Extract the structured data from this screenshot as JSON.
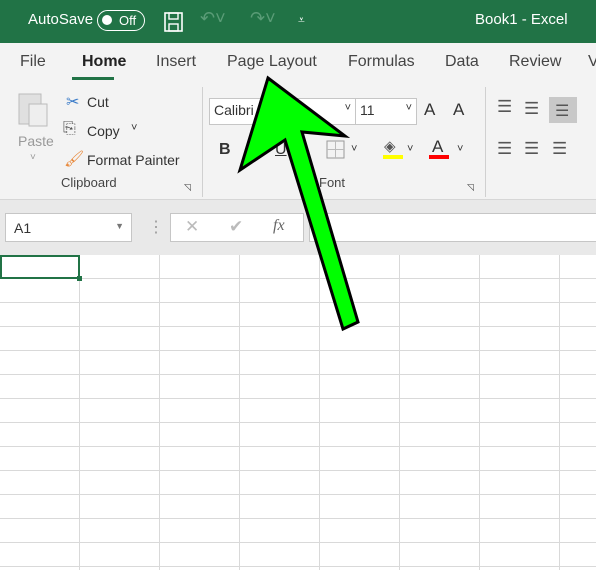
{
  "titlebar": {
    "autosave_label": "AutoSave",
    "autosave_state": "Off",
    "title": "Book1  -  Excel"
  },
  "tabs": [
    {
      "label": "File"
    },
    {
      "label": "Home",
      "active": true
    },
    {
      "label": "Insert"
    },
    {
      "label": "Page Layout"
    },
    {
      "label": "Formulas"
    },
    {
      "label": "Data"
    },
    {
      "label": "Review"
    },
    {
      "label": "V"
    }
  ],
  "clipboard": {
    "paste": "Paste",
    "cut": "Cut",
    "copy": "Copy",
    "format_painter": "Format Painter",
    "group_label": "Clipboard"
  },
  "font": {
    "font_name": "Calibri",
    "font_size": "11",
    "bold": "B",
    "italic": "I",
    "underline": "U",
    "font_color_glyph": "A",
    "grow": "A",
    "shrink": "A",
    "group_label": "Font",
    "highlight_color": "#ffff00",
    "font_color": "#ff0000"
  },
  "formula_bar": {
    "name_box": "A1",
    "fx": "fx",
    "value": ""
  },
  "selected_cell": "A1",
  "colors": {
    "accent": "#217346",
    "arrow": "#00ff00"
  }
}
